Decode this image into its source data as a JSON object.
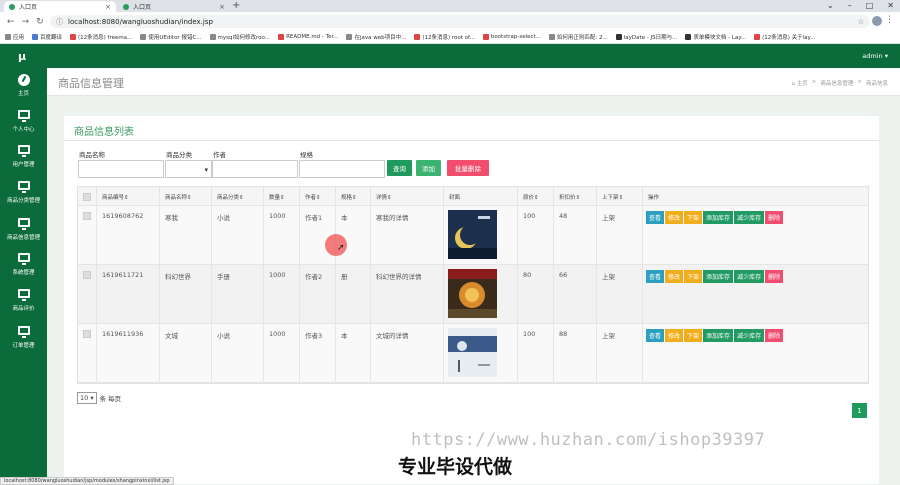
{
  "browser": {
    "tabs": [
      {
        "title": "入口页",
        "close": "×"
      },
      {
        "title": "入口页",
        "close": "×"
      }
    ],
    "new_tab": "+",
    "window_controls": [
      "⌄",
      "–",
      "□",
      "✕"
    ],
    "url": "localhost:8080/wangluoshudian/index.jsp",
    "bookmarks": [
      {
        "label": "应用",
        "icon": "apps-icon"
      },
      {
        "label": "百度翻译",
        "icon": "baidu-icon"
      },
      {
        "label": "(12条消息) freema...",
        "icon": "csdn-icon"
      },
      {
        "label": "使用UEditor 报错C...",
        "icon": "generic-icon"
      },
      {
        "label": "mysql如何修改roo...",
        "icon": "generic-icon"
      },
      {
        "label": "README.md - Ter...",
        "icon": "generic-icon"
      },
      {
        "label": "在java web项目中...",
        "icon": "generic-icon"
      },
      {
        "label": "(12条消息) root of...",
        "icon": "csdn-icon"
      },
      {
        "label": "bootstrap-select...",
        "icon": "generic-icon"
      },
      {
        "label": "如何用正则匹配: 2...",
        "icon": "generic-icon"
      },
      {
        "label": "layDate - JS日期与...",
        "icon": "generic-icon"
      },
      {
        "label": "表单模块文档 - Lay...",
        "icon": "generic-icon"
      },
      {
        "label": "(12条消息) 关于lay...",
        "icon": "csdn-icon"
      }
    ]
  },
  "app": {
    "logo": "μ",
    "user": "admin ▾"
  },
  "sidebar": {
    "items": [
      {
        "label": "主页",
        "icon": "dashboard-icon"
      },
      {
        "label": "个人中心",
        "icon": "monitor-icon"
      },
      {
        "label": "用户管理",
        "icon": "monitor-icon"
      },
      {
        "label": "商品分类管理",
        "icon": "monitor-icon"
      },
      {
        "label": "商品信息管理",
        "icon": "monitor-icon"
      },
      {
        "label": "系统管理",
        "icon": "monitor-icon"
      },
      {
        "label": "商品评价",
        "icon": "monitor-icon"
      },
      {
        "label": "订单管理",
        "icon": "monitor-icon"
      }
    ]
  },
  "page": {
    "title": "商品信息管理",
    "breadcrumb": [
      "⌂ 主页",
      ">",
      "商品信息管理",
      ">",
      "商品信息"
    ]
  },
  "panel": {
    "title": "商品信息列表",
    "filters": {
      "name_label": "商品名称",
      "category_label": "商品分类",
      "author_label": "作者",
      "spec_label": "规格",
      "name_value": "",
      "category_value": "▾",
      "author_value": "",
      "spec_value": ""
    },
    "buttons": {
      "search": "查询",
      "add": "添加",
      "batch_delete": "批量删除"
    },
    "columns": [
      "",
      "商品编号⇕",
      "商品名称⇕",
      "商品分类⇕",
      "数量⇕",
      "作者⇕",
      "规格⇕",
      "详情⇕",
      "封面",
      "原价⇕",
      "折扣价⇕",
      "上下架⇕",
      "操作"
    ],
    "rows": [
      {
        "id": "1619608762",
        "name": "寒我",
        "category": "小说",
        "qty": "1000",
        "author": "作者1",
        "spec": "本",
        "detail": "寒我的详情",
        "price": "100",
        "discount": "48",
        "status": "上架"
      },
      {
        "id": "1619611721",
        "name": "科幻世界",
        "category": "手册",
        "qty": "1000",
        "author": "作者2",
        "spec": "册",
        "detail": "科幻世界的详情",
        "price": "80",
        "discount": "66",
        "status": "上架"
      },
      {
        "id": "1619611936",
        "name": "文城",
        "category": "小说",
        "qty": "1000",
        "author": "作者3",
        "spec": "本",
        "detail": "文城的详情",
        "price": "100",
        "discount": "88",
        "status": "上架"
      }
    ],
    "row_actions": {
      "view": "查看",
      "edit": "修改",
      "offshelf": "下架",
      "add_stock": "添加库存",
      "reduce_stock": "减少库存",
      "delete": "删除"
    },
    "pager": {
      "page_size": "10 ▾",
      "suffix": "条 每页",
      "current_page": "1"
    }
  },
  "overlay": {
    "watermark": "https://www.huzhan.com/ishop39397",
    "caption": "专业毕设代做"
  },
  "status_bar": "localhost:8080/wangluoshudian/jsp/modules/shangpinxinxi/list.jsp",
  "colors": {
    "brand": "#0b6b3a",
    "accent": "#1f9a5c",
    "danger": "#f14e6f",
    "warning": "#f0ad1c",
    "info": "#2a9fbf"
  }
}
